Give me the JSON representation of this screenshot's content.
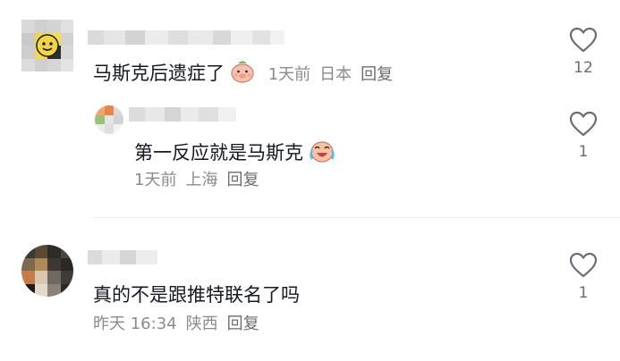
{
  "comments": [
    {
      "text": "马斯克后遗症了",
      "emoji_icon": "pig-shy-emoji-icon",
      "time": "1天前",
      "location": "日本",
      "reply_label": "回复",
      "likes": "12",
      "replies": [
        {
          "text": "第一反应就是马斯克",
          "emoji_icon": "crying-laughing-emoji-icon",
          "time": "1天前",
          "location": "上海",
          "reply_label": "回复",
          "likes": "1"
        }
      ]
    },
    {
      "text": "真的不是跟推特联名了吗",
      "time": "昨天 16:34",
      "location": "陕西",
      "reply_label": "回复",
      "likes": "1"
    }
  ],
  "colors": {
    "text": "#161823",
    "meta": "#8a8b91",
    "divider": "#ececee",
    "heart_outline": "#6b6c73"
  }
}
